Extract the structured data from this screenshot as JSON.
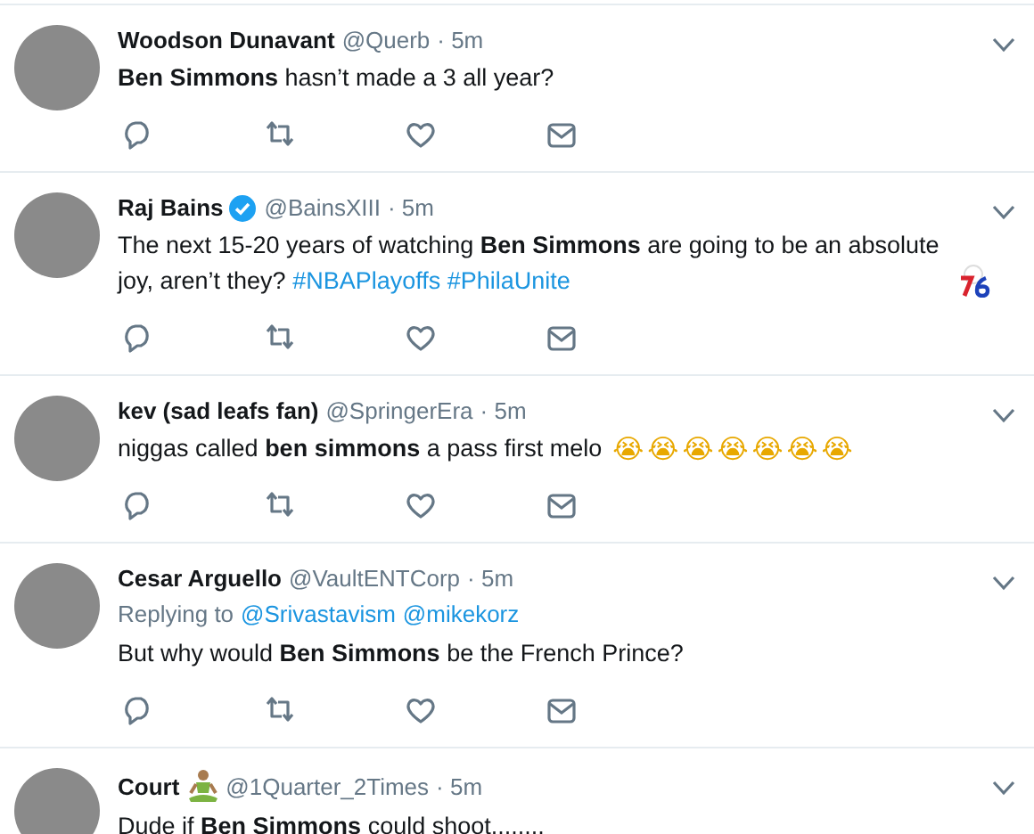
{
  "tweets": [
    {
      "name": "Woodson Dunavant",
      "verified": false,
      "handle": "@Querb",
      "time": "· 5m",
      "text": "**Ben Simmons** hasn’t made a 3 all year?",
      "team_logo": false,
      "name_icon": false
    },
    {
      "name": "Raj Bains",
      "verified": true,
      "handle": "@BainsXIII",
      "time": "· 5m",
      "text": "The next 15-20 years of watching **Ben Simmons** are going to be an absolute joy, aren’t they?",
      "links": [
        "#NBAPlayoffs",
        "#PhilaUnite"
      ],
      "team_logo": true,
      "name_icon": false
    },
    {
      "name": "kev (sad leafs fan)",
      "verified": false,
      "handle": "@SpringerEra",
      "time": "· 5m",
      "text": "niggas called **ben simmons** a pass first melo",
      "emoji": "😭😭😭😭😭😭😭",
      "team_logo": false,
      "name_icon": false
    },
    {
      "name": "Cesar Arguello",
      "verified": false,
      "handle": "@VaultENTCorp",
      "time": "· 5m",
      "replying_label": "Replying to",
      "replying_to": [
        "@Srivastavism",
        "@mikekorz"
      ],
      "text": "But why would **Ben Simmons** be the French Prince?",
      "team_logo": false,
      "name_icon": false
    },
    {
      "name": "Court",
      "name_icon": true,
      "verified": false,
      "handle": "@1Quarter_2Times",
      "time": "· 5m",
      "text": "Dude if **Ben Simmons** could shoot........",
      "team_logo": false
    }
  ]
}
